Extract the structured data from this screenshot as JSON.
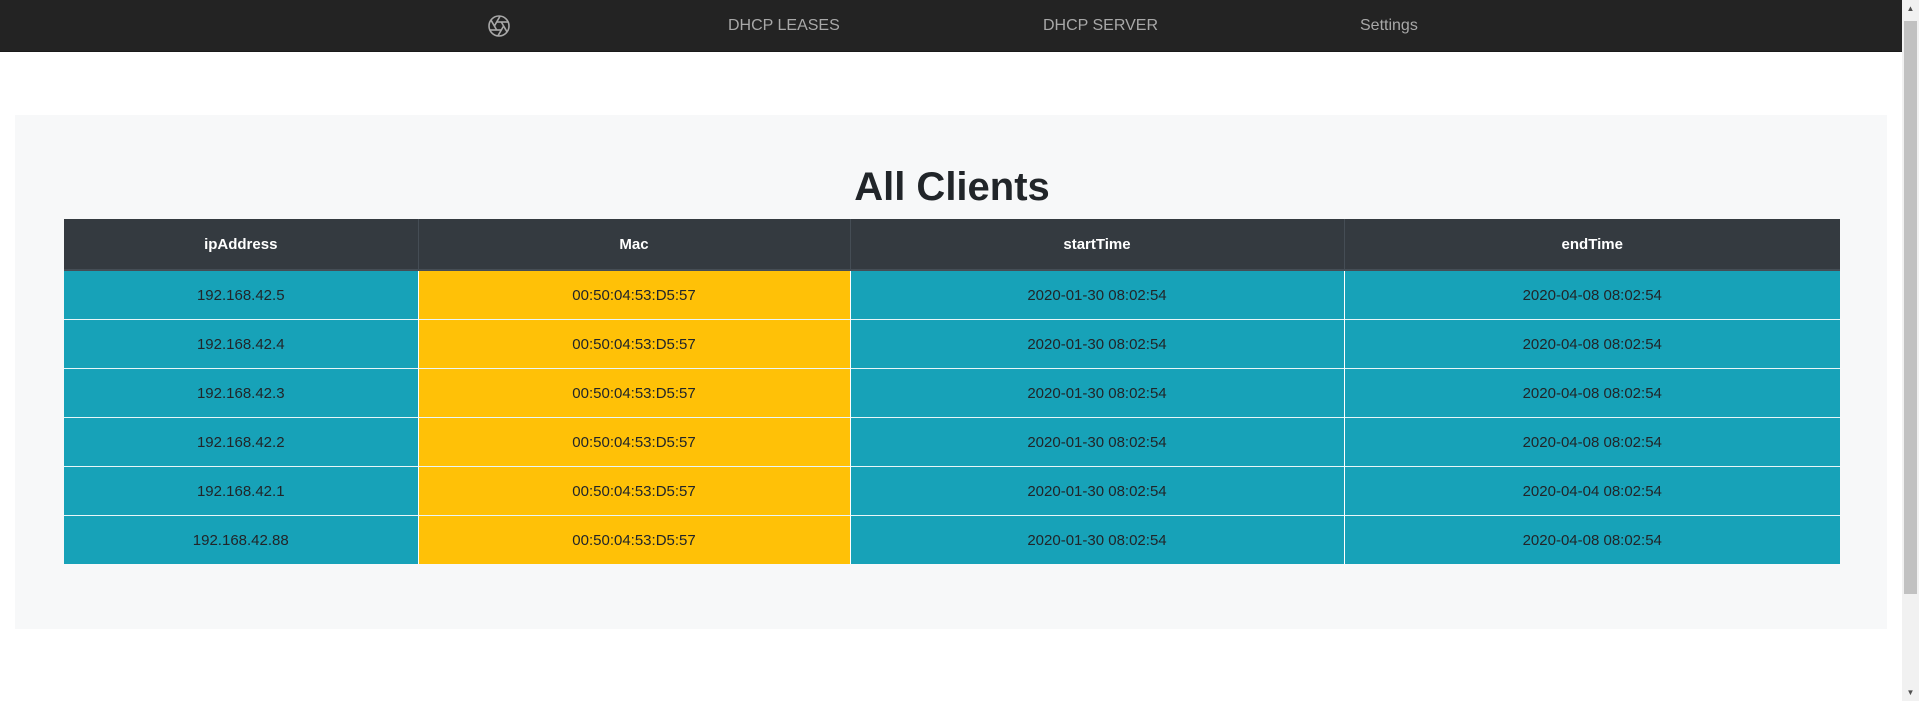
{
  "nav": {
    "logo_icon": "aperture-icon",
    "links": [
      "DHCP LEASES",
      "DHCP SERVER",
      "Settings"
    ]
  },
  "page": {
    "title": "All Clients"
  },
  "table": {
    "headers": [
      "ipAddress",
      "Mac",
      "startTime",
      "endTime"
    ],
    "rows": [
      [
        "192.168.42.5",
        "00:50:04:53:D5:57",
        "2020-01-30 08:02:54",
        "2020-04-08 08:02:54"
      ],
      [
        "192.168.42.4",
        "00:50:04:53:D5:57",
        "2020-01-30 08:02:54",
        "2020-04-08 08:02:54"
      ],
      [
        "192.168.42.3",
        "00:50:04:53:D5:57",
        "2020-01-30 08:02:54",
        "2020-04-08 08:02:54"
      ],
      [
        "192.168.42.2",
        "00:50:04:53:D5:57",
        "2020-01-30 08:02:54",
        "2020-04-08 08:02:54"
      ],
      [
        "192.168.42.1",
        "00:50:04:53:D5:57",
        "2020-01-30 08:02:54",
        "2020-04-04 08:02:54"
      ],
      [
        "192.168.42.88",
        "00:50:04:53:D5:57",
        "2020-01-30 08:02:54",
        "2020-04-08 08:02:54"
      ]
    ]
  },
  "colors": {
    "navbar": "#232323",
    "header_row": "#343a40",
    "info_cell": "#17a2b8",
    "warning_cell": "#ffc107",
    "panel": "#f7f8f9"
  }
}
